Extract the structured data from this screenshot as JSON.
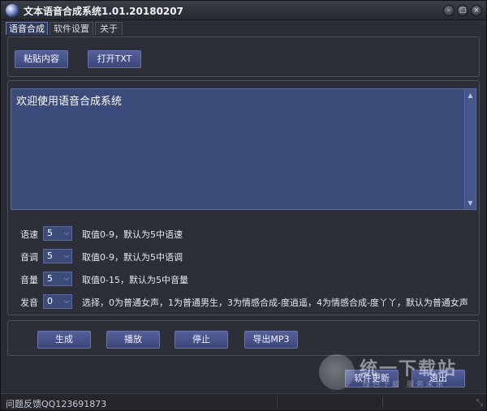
{
  "window": {
    "title": "文本语音合成系统1.01.20180207"
  },
  "window_controls": {
    "minimize": "–",
    "restore": "□",
    "close": "×"
  },
  "tabs": [
    {
      "label": "语音合成",
      "active": true
    },
    {
      "label": "软件设置",
      "active": false
    },
    {
      "label": "关于",
      "active": false
    }
  ],
  "top_buttons": {
    "paste": "粘贴内容",
    "open_txt": "打开TXT"
  },
  "editor": {
    "text": "欢迎使用语音合成系统"
  },
  "settings": [
    {
      "label": "语速",
      "value": "5",
      "hint": "取值0-9，默认为5中语速"
    },
    {
      "label": "音调",
      "value": "5",
      "hint": "取值0-9，默认为5中语调"
    },
    {
      "label": "音量",
      "value": "5",
      "hint": "取值0-15，默认为5中音量"
    },
    {
      "label": "发音",
      "value": "0",
      "hint": "选择，0为普通女声，1为普通男生，3为情感合成-度逍遥，4为情感合成-度丫丫，默认为普通女声"
    }
  ],
  "action_buttons": {
    "generate": "生成",
    "play": "播放",
    "stop": "停止",
    "export_mp3": "导出MP3"
  },
  "bottom_buttons": {
    "software_update": "软件更新",
    "exit": "退出"
  },
  "status": {
    "feedback": "问题反馈QQ123691873"
  },
  "watermark": {
    "title": "统一下载站",
    "subtitle": "绿色下载 服务未来"
  },
  "colors": {
    "accent": "#3b4b7a",
    "button": "#4a5690",
    "background": "#2a2d35"
  }
}
